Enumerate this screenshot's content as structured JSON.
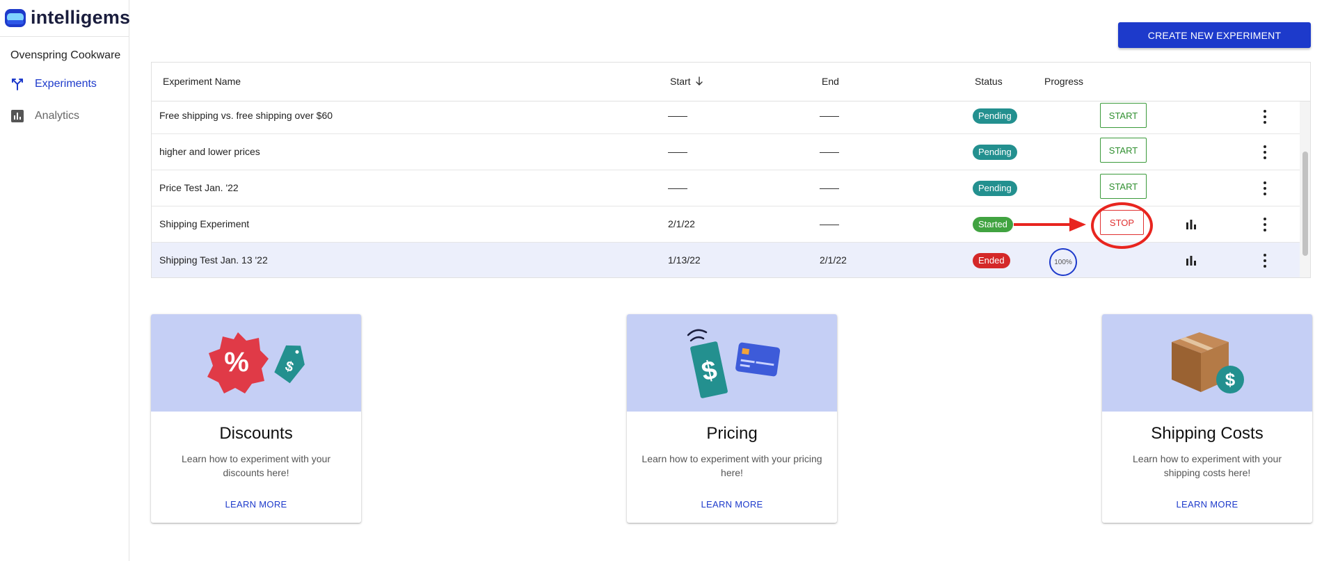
{
  "app": {
    "logo_text": "intelligems"
  },
  "sidebar": {
    "store_name": "Ovenspring Cookware",
    "items": [
      {
        "label": "Experiments",
        "icon": "branch-icon",
        "active": true
      },
      {
        "label": "Analytics",
        "icon": "bar-chart-icon",
        "active": false
      }
    ]
  },
  "toolbar": {
    "create_label": "CREATE NEW EXPERIMENT"
  },
  "table": {
    "headers": {
      "name": "Experiment Name",
      "start": "Start",
      "end": "End",
      "status": "Status",
      "progress": "Progress"
    },
    "rows": [
      {
        "name": "Free shipping vs. free shipping over $60",
        "start": "——",
        "end": "——",
        "status": "Pending",
        "action": "START"
      },
      {
        "name": "higher and lower prices",
        "start": "——",
        "end": "——",
        "status": "Pending",
        "action": "START"
      },
      {
        "name": "Price Test Jan. '22",
        "start": "——",
        "end": "——",
        "status": "Pending",
        "action": "START"
      },
      {
        "name": "Shipping Experiment",
        "start": "2/1/22",
        "end": "——",
        "status": "Started",
        "action": "STOP"
      },
      {
        "name": "Shipping Test Jan. 13 '22",
        "start": "1/13/22",
        "end": "2/1/22",
        "status": "Ended",
        "progress": "100%"
      }
    ]
  },
  "cards": [
    {
      "title": "Discounts",
      "desc": "Learn how to experiment with your discounts here!",
      "link": "LEARN MORE"
    },
    {
      "title": "Pricing",
      "desc": "Learn how to experiment with your pricing here!",
      "link": "LEARN MORE"
    },
    {
      "title": "Shipping Costs",
      "desc": "Learn how to experiment with your shipping costs here!",
      "link": "LEARN MORE"
    }
  ],
  "colors": {
    "accent": "#1d3acb",
    "pending": "#23908f",
    "started": "#41a341",
    "ended": "#d42828",
    "card_bg": "#c5cff5"
  }
}
